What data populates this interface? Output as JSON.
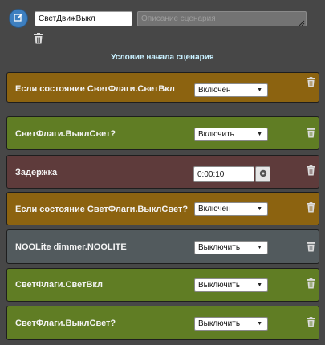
{
  "header": {
    "name_value": "СветДвижВыкл",
    "description_placeholder": "Описание сценария",
    "condition_title": "Условие начала сценария"
  },
  "rows": [
    {
      "type": "condition",
      "label": "Если состояние СветФлаги.СветВкл",
      "value": "Включен"
    },
    {
      "type": "action",
      "label": "СветФлаги.ВыклСвет?",
      "value": "Включить"
    },
    {
      "type": "delay",
      "label": "Задержка",
      "value": "0:00:10"
    },
    {
      "type": "condition",
      "label": "Если состояние СветФлаги.ВыклСвет?",
      "value": "Включен"
    },
    {
      "type": "device",
      "label": "NOOLite dimmer.NOOLITE",
      "value": "Выключить"
    },
    {
      "type": "action",
      "label": "СветФлаги.СветВкл",
      "value": "Выключить"
    },
    {
      "type": "action",
      "label": "СветФлаги.ВыклСвет?",
      "value": "Выключить"
    }
  ],
  "icons": {
    "edit": "edit-icon",
    "trash": "trash-icon",
    "select_arrow": "chevron-down-icon",
    "clock": "clock-icon",
    "resize": "resize-grip-icon"
  },
  "colors": {
    "background": "#474747",
    "condition_row": "#8c6310",
    "action_row": "#607d24",
    "delay_row": "#5e3b3b",
    "device_row": "#525a5d",
    "edit_button": "#3d7fc0",
    "condition_title": "#c8f0ff"
  }
}
